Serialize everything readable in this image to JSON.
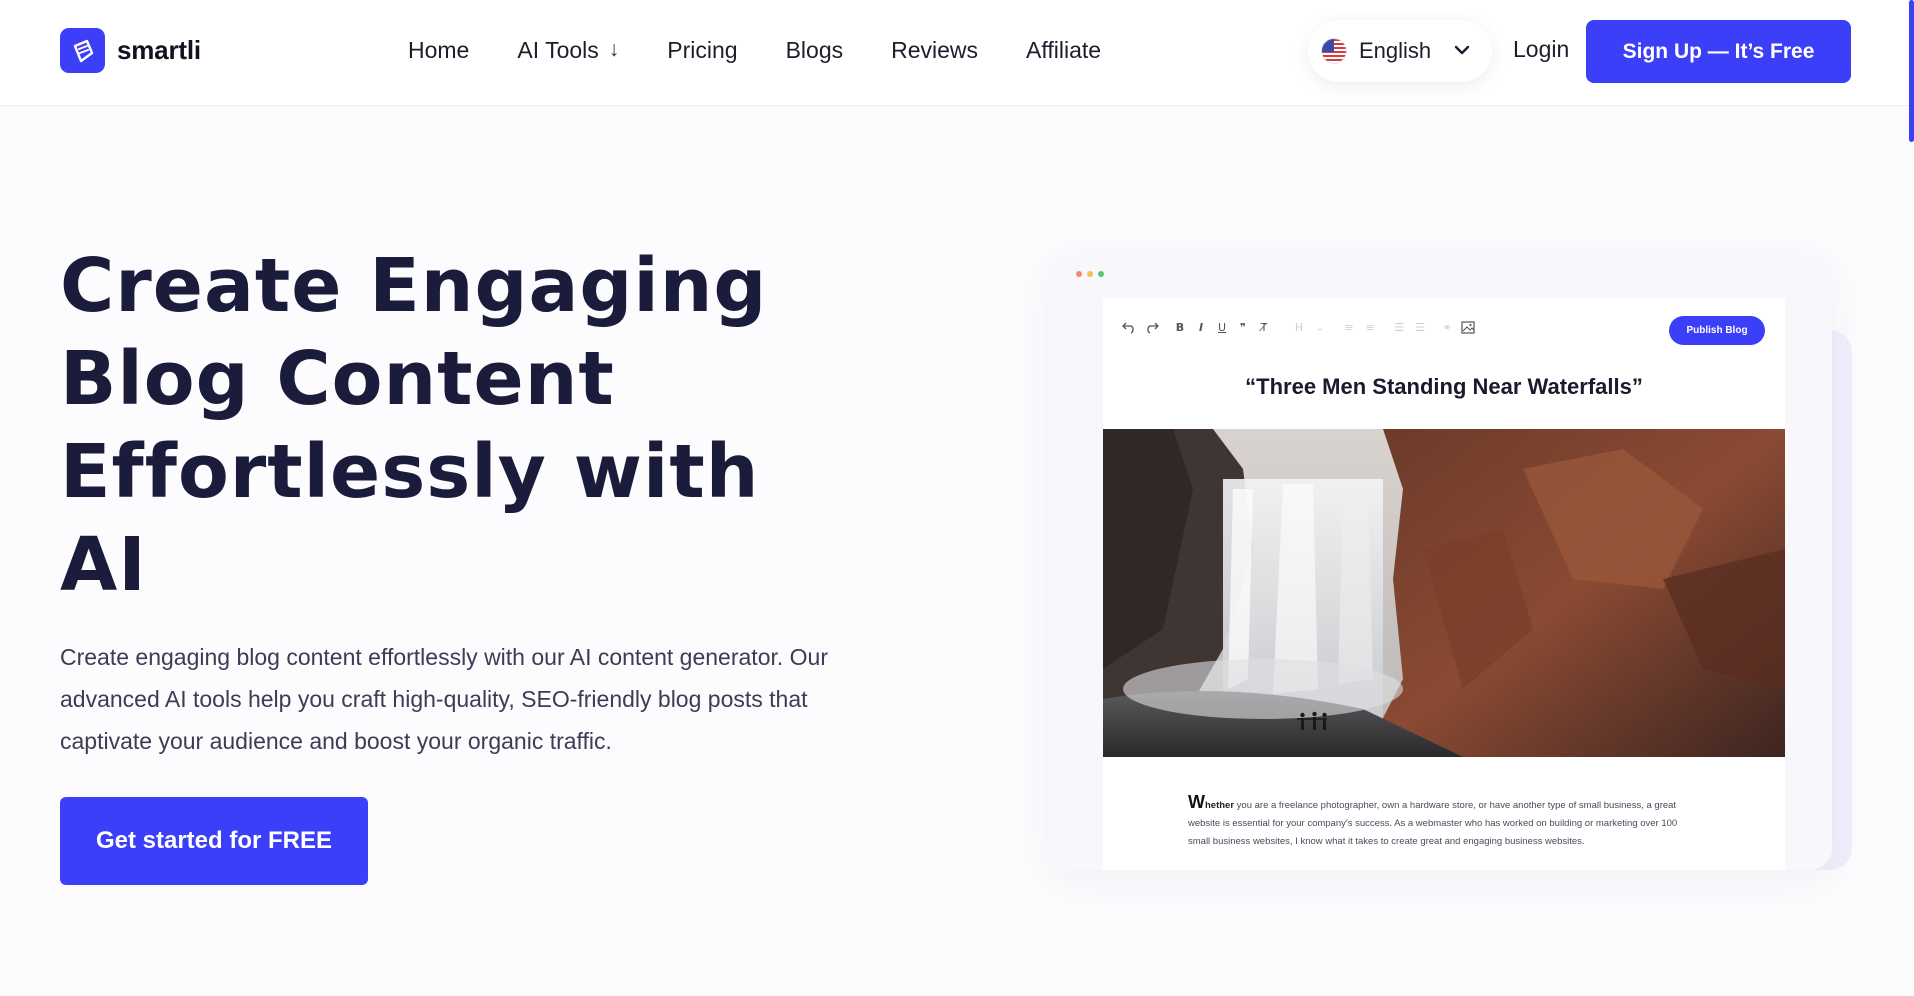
{
  "header": {
    "logo_text": "smartli",
    "nav": [
      {
        "label": "Home"
      },
      {
        "label": "AI Tools",
        "arrow": "↓"
      },
      {
        "label": "Pricing"
      },
      {
        "label": "Blogs"
      },
      {
        "label": "Reviews"
      },
      {
        "label": "Affiliate"
      }
    ],
    "language": {
      "label": "English",
      "flag_icon": "us-flag-icon"
    },
    "login_label": "Login",
    "signup_label": "Sign Up — It’s Free"
  },
  "hero": {
    "title_lines": [
      "Create Engaging",
      "Blog Content",
      "Effortlessly with",
      "AI"
    ],
    "description_lines": [
      "Create engaging blog content effortlessly with our AI content generator. Our",
      "advanced AI tools help you craft high-quality, SEO-friendly blog posts that",
      "captivate your audience and boost your organic traffic."
    ],
    "cta_label": "Get started for FREE"
  },
  "editor": {
    "publish_label": "Publish Blog",
    "toolbar_icons": [
      "undo-icon",
      "redo-icon",
      "bold-icon",
      "italic-icon",
      "underline-icon",
      "quote-icon",
      "clear-format-icon",
      "heading-icon",
      "align-left-icon",
      "align-center-icon",
      "bullet-list-icon",
      "numbered-list-icon",
      "link-icon",
      "image-icon"
    ],
    "doc_title": "“Three Men Standing Near Waterfalls”",
    "body_dropcap": "W",
    "body_first": "hether",
    "body_lines": [
      " you are a freelance photographer, own a hardware store, or have another type of small business, a great",
      "website is essential for your company's success. As a webmaster who has worked on building or marketing over 100",
      "small business websites, I know what it takes to create great and engaging business websites."
    ]
  },
  "colors": {
    "accent": "#3c3ff8",
    "heading": "#1b1b3b",
    "body_text": "#3c3c55"
  }
}
